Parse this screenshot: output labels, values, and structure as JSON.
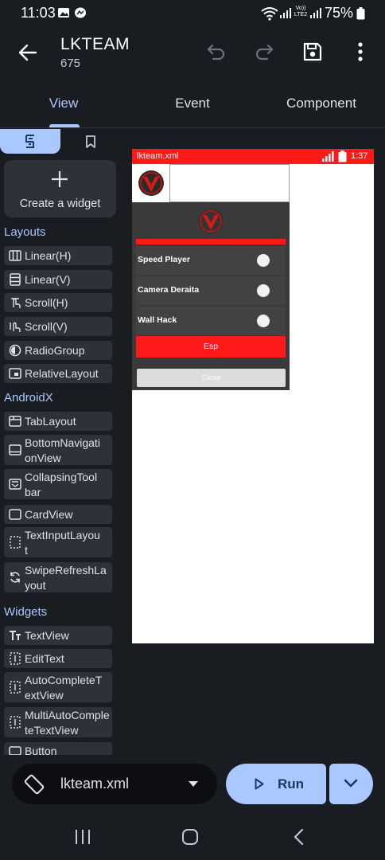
{
  "status_bar": {
    "time": "11:03",
    "battery": "75%",
    "network_label": "Vo)) LTE2",
    "icons": [
      "gallery-notification-icon",
      "messenger-notification-icon",
      "wifi-icon",
      "signal-icon",
      "signal-lte-icon",
      "battery-icon"
    ]
  },
  "toolbar": {
    "title": "LKTEAM",
    "subtitle": "675",
    "icons": [
      "back-arrow-icon",
      "undo-icon",
      "redo-icon",
      "save-icon",
      "more-vert-icon"
    ]
  },
  "tabs": [
    {
      "label": "View",
      "active": true
    },
    {
      "label": "Event",
      "active": false
    },
    {
      "label": "Component",
      "active": false
    }
  ],
  "palette": {
    "create_widget_label": "Create a widget",
    "sections": {
      "layouts": {
        "header": "Layouts",
        "items": [
          {
            "label": "Linear(H)",
            "icon": "linear-horizontal-icon"
          },
          {
            "label": "Linear(V)",
            "icon": "linear-vertical-icon"
          },
          {
            "label": "Scroll(H)",
            "icon": "scroll-horizontal-icon"
          },
          {
            "label": "Scroll(V)",
            "icon": "scroll-vertical-icon"
          },
          {
            "label": "RadioGroup",
            "icon": "radio-group-icon"
          },
          {
            "label": "RelativeLayout",
            "icon": "relative-layout-icon"
          }
        ]
      },
      "androidx": {
        "header": "AndroidX",
        "items": [
          {
            "label": "TabLayout",
            "icon": "tab-layout-icon"
          },
          {
            "label": "BottomNavigationView",
            "line1": "BottomNavigati",
            "line2": "onView",
            "icon": "bottom-navigation-icon"
          },
          {
            "label": "CollapsingToolbar",
            "line1": "CollapsingTool",
            "line2": "bar",
            "icon": "collapsing-toolbar-icon"
          },
          {
            "label": "CardView",
            "icon": "card-view-icon"
          },
          {
            "label": "TextInputLayout",
            "line1": "TextInputLayou",
            "line2": "t",
            "icon": "text-input-layout-icon"
          },
          {
            "label": "SwipeRefreshLayout",
            "line1": "SwipeRefreshLa",
            "line2": "yout",
            "icon": "swipe-refresh-icon"
          }
        ]
      },
      "widgets": {
        "header": "Widgets",
        "items": [
          {
            "label": "TextView",
            "icon": "text-view-icon"
          },
          {
            "label": "EditText",
            "icon": "edit-text-icon"
          },
          {
            "label": "AutoCompleteTextView",
            "line1": "AutoCompleteT",
            "line2": "extView",
            "icon": "autocomplete-icon"
          },
          {
            "label": "MultiAutoCompleteTextView",
            "line1": "MultiAutoComple",
            "line2": "teTextView",
            "icon": "multi-autocomplete-icon"
          },
          {
            "label": "Button",
            "icon": "button-icon"
          }
        ]
      }
    }
  },
  "preview": {
    "status_filename": "lkteam.xml",
    "status_time": "1:37",
    "rows": [
      {
        "label": "Speed Player"
      },
      {
        "label": "Camera Deraita"
      },
      {
        "label": "Wall Hack"
      }
    ],
    "esp_button_label": "Esp",
    "close_button_label": "Close",
    "accent_color": "#ff1a1a"
  },
  "bottom_bar": {
    "file_name": "lkteam.xml",
    "run_label": "Run"
  },
  "colors": {
    "background": "#191c20",
    "primary": "#a8c8ff",
    "surface": "#2e3137"
  }
}
